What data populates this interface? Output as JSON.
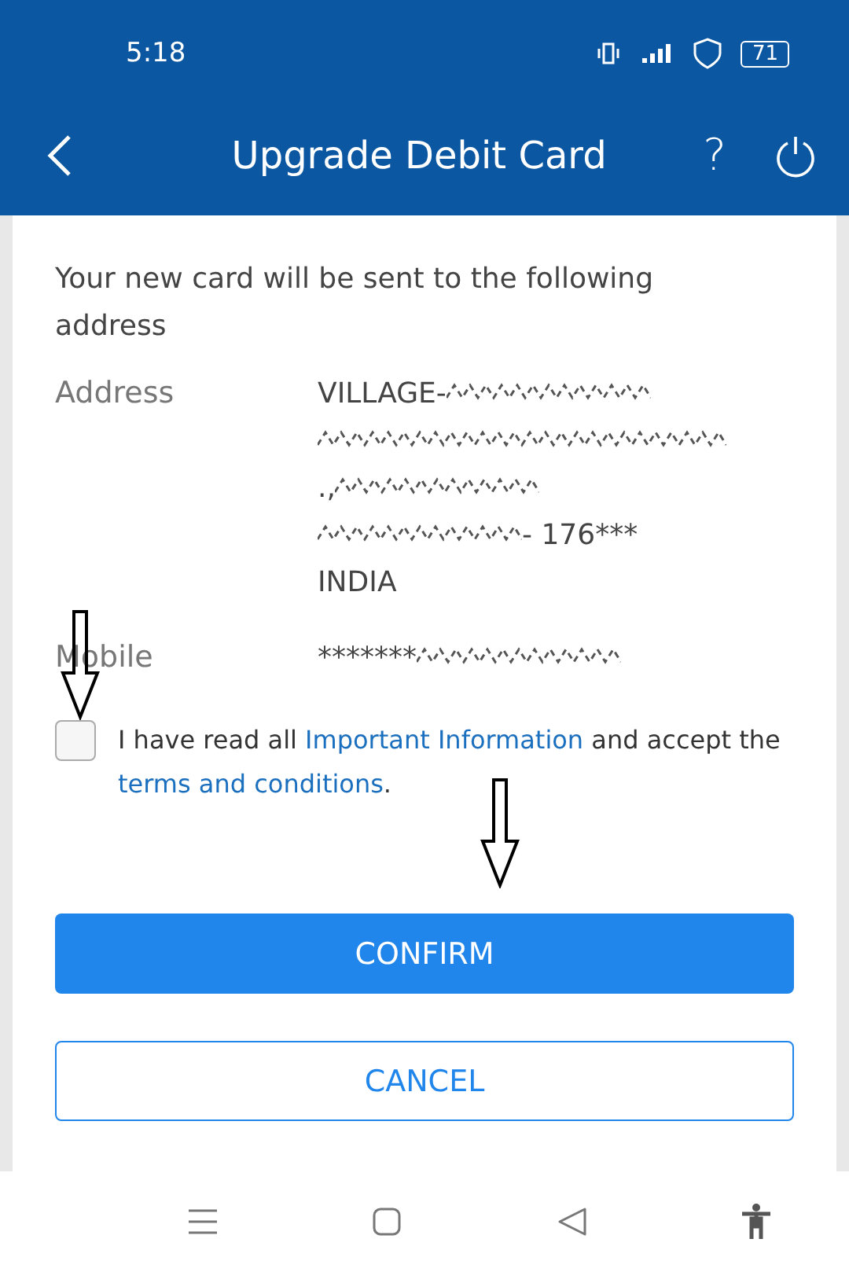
{
  "status_bar": {
    "time": "5:18",
    "battery": "71"
  },
  "header": {
    "title": "Upgrade Debit Card",
    "help": "?"
  },
  "intro": "Your new card will be sent to the following address",
  "details": [
    {
      "label": "Address",
      "lines": [
        [
          {
            "kind": "text",
            "text": "VILLAGE-"
          },
          {
            "kind": "redacted"
          }
        ],
        [
          {
            "kind": "redacted"
          }
        ],
        [
          {
            "kind": "text",
            "text": ".,"
          },
          {
            "kind": "redacted"
          }
        ],
        [
          {
            "kind": "redacted"
          },
          {
            "kind": "text",
            "text": "- 176***"
          }
        ],
        [
          {
            "kind": "text",
            "text": "INDIA"
          }
        ]
      ]
    },
    {
      "label": "Mobile",
      "lines": [
        [
          {
            "kind": "text",
            "text": "*******"
          },
          {
            "kind": "redacted"
          }
        ]
      ]
    }
  ],
  "consent": {
    "checked": false,
    "parts": [
      {
        "kind": "text",
        "text": "I have read all "
      },
      {
        "kind": "link",
        "text": "Important Information"
      },
      {
        "kind": "text",
        "text": " and accept the "
      },
      {
        "kind": "link",
        "text": "terms and conditions"
      },
      {
        "kind": "text",
        "text": "."
      }
    ]
  },
  "buttons": [
    {
      "kind": "primary",
      "label": "CONFIRM"
    },
    {
      "kind": "outline",
      "label": "CANCEL"
    }
  ]
}
